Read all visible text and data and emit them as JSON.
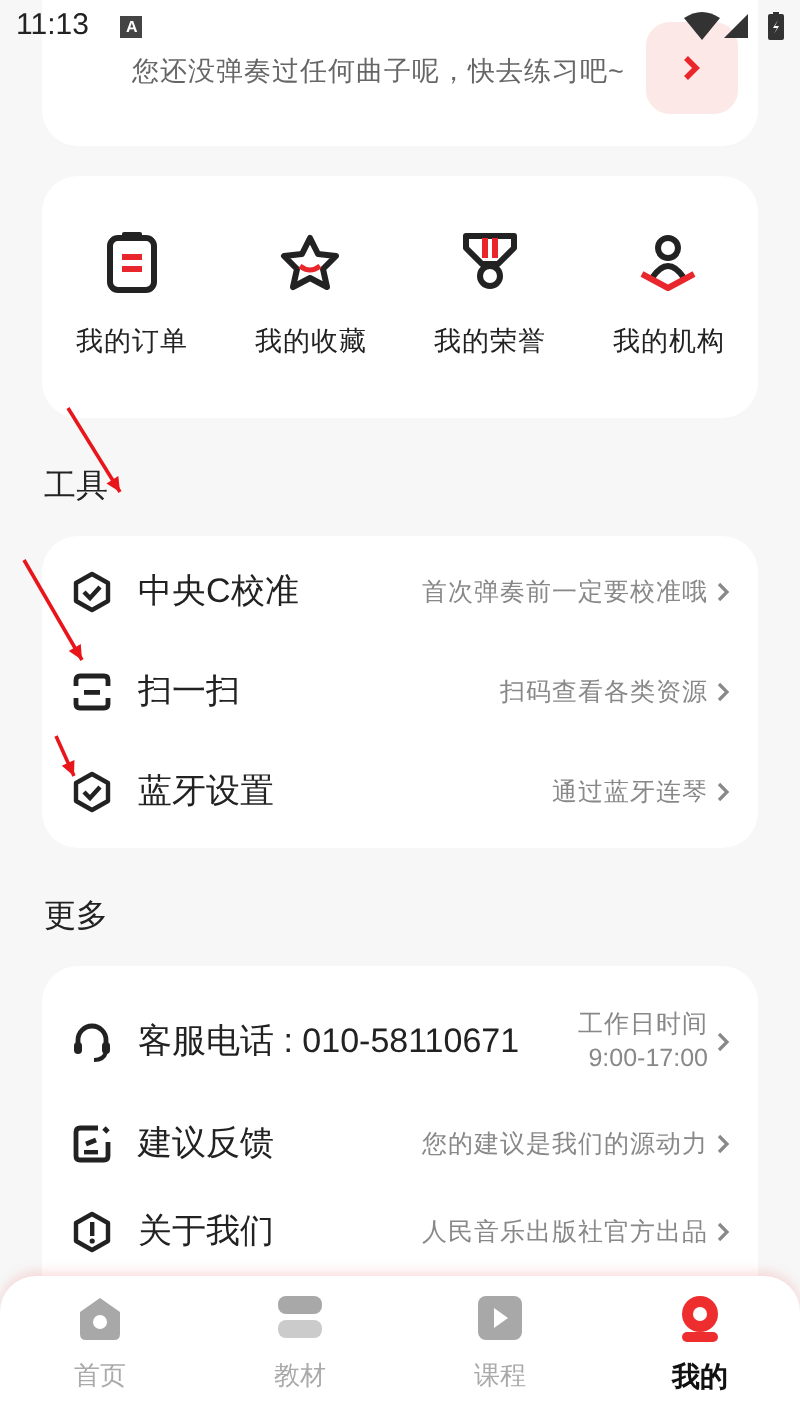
{
  "status_bar": {
    "time": "11:13",
    "notification": "A"
  },
  "practice_card": {
    "message": "您还没弹奏过任何曲子呢，快去练习吧~"
  },
  "shortcuts": [
    {
      "label": "我的订单",
      "kind": "orders"
    },
    {
      "label": "我的收藏",
      "kind": "favorites"
    },
    {
      "label": "我的荣誉",
      "kind": "honors"
    },
    {
      "label": "我的机构",
      "kind": "institution"
    }
  ],
  "tools": {
    "title": "工具",
    "items": [
      {
        "label": "中央C校准",
        "hint": "首次弹奏前一定要校准哦",
        "kind": "check"
      },
      {
        "label": "扫一扫",
        "hint": "扫码查看各类资源",
        "kind": "scan"
      },
      {
        "label": "蓝牙设置",
        "hint": "通过蓝牙连琴",
        "kind": "check"
      }
    ]
  },
  "more": {
    "title": "更多",
    "items": [
      {
        "label": "客服电话 : 010-58110671",
        "hint": "工作日时间",
        "hint_2": "9:00-17:00",
        "kind": "phone"
      },
      {
        "label": "建议反馈",
        "hint": "您的建议是我们的源动力",
        "kind": "feedback"
      },
      {
        "label": "关于我们",
        "hint": "人民音乐出版社官方出品",
        "kind": "info"
      }
    ]
  },
  "tab_bar": [
    {
      "label": "首页",
      "kind": "home",
      "selected": false
    },
    {
      "label": "教材",
      "kind": "books",
      "selected": false
    },
    {
      "label": "课程",
      "kind": "video",
      "selected": false
    },
    {
      "label": "我的",
      "kind": "profile",
      "selected": true
    }
  ]
}
